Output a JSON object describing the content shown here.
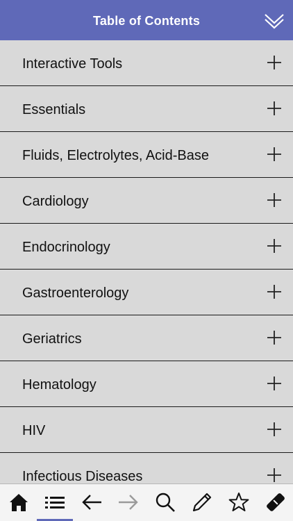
{
  "header": {
    "title": "Table of Contents",
    "collapse_icon": "double-chevron-down-icon",
    "background_color": "#5f69b8"
  },
  "toc": {
    "items": [
      {
        "label": "Interactive Tools"
      },
      {
        "label": "Essentials"
      },
      {
        "label": "Fluids, Electrolytes, Acid-Base"
      },
      {
        "label": "Cardiology"
      },
      {
        "label": "Endocrinology"
      },
      {
        "label": "Gastroenterology"
      },
      {
        "label": "Geriatrics"
      },
      {
        "label": "Hematology"
      },
      {
        "label": "HIV"
      },
      {
        "label": "Infectious Diseases"
      }
    ],
    "expand_icon": "plus-icon",
    "row_color": "#d9d9d9"
  },
  "toolbar": {
    "buttons": [
      {
        "icon": "home-icon"
      },
      {
        "icon": "list-icon",
        "active": true
      },
      {
        "icon": "back-arrow-icon"
      },
      {
        "icon": "forward-arrow-icon",
        "disabled": true
      },
      {
        "icon": "search-icon"
      },
      {
        "icon": "pencil-icon"
      },
      {
        "icon": "star-icon"
      },
      {
        "icon": "eraser-icon"
      }
    ],
    "active_color": "#5f69b8"
  }
}
